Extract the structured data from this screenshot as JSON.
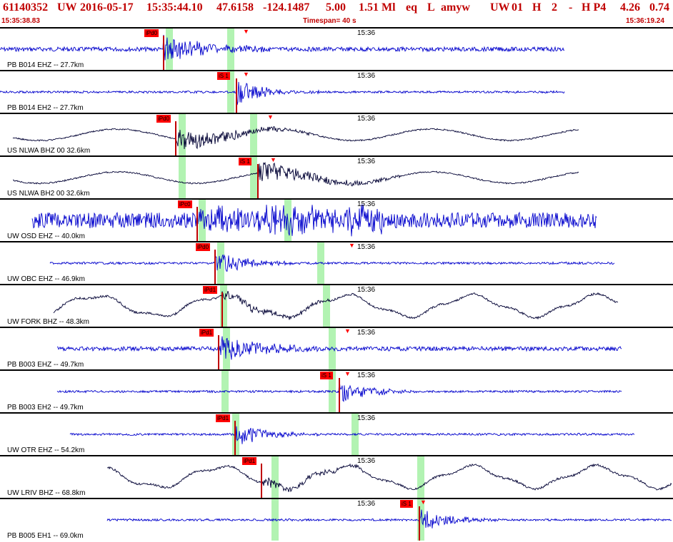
{
  "header": {
    "evid": "61140352",
    "net": "UW",
    "date": "2016-05-17",
    "time": "15:35:44.10",
    "lat": "47.6158",
    "lon": "-124.1487",
    "depth": "5.00",
    "mag": "1.51 Ml",
    "etype": "eq",
    "status": "L",
    "author": "amyw",
    "src": "UW",
    "ver": "01",
    "gtype": "H",
    "n": "2",
    "dash": "-",
    "q": "H P4",
    "rms": "4.26",
    "err": "0.74"
  },
  "subheader": {
    "start": "15:35:38.83",
    "timespan": "Timespan=  40 s",
    "end": "15:36:19.24"
  },
  "colors": {
    "header_red": "#c00000",
    "trace_blue": "#0000cc",
    "trace_dark": "#000033",
    "pick_green": "#aaf2aa",
    "pick_red": "#ff0000"
  },
  "channels": [
    {
      "label": "PB B014 EHZ --  27.7km",
      "time_mark": "15:36",
      "pick": "iPd0",
      "trace_color": "#0000cc",
      "style": "noise_burst"
    },
    {
      "label": "PB B014 EH2 --  27.7km",
      "time_mark": "15:36",
      "pick": "iS 1",
      "trace_color": "#0000cc",
      "style": "quiet_burst"
    },
    {
      "label": "US NLWA BHZ 00  32.6km",
      "time_mark": "15:36",
      "pick": "iPd0",
      "trace_color": "#000033",
      "style": "long_period"
    },
    {
      "label": "US NLWA BH2 00  32.6km",
      "time_mark": "15:36",
      "pick": "iS 1",
      "trace_color": "#000033",
      "style": "long_period"
    },
    {
      "label": "UW OSD EHZ --  40.0km",
      "time_mark": "15:36",
      "pick": "iPc0",
      "trace_color": "#0000cc",
      "style": "very_noisy"
    },
    {
      "label": "UW OBC EHZ --  46.9km",
      "time_mark": "15:36",
      "pick": "iPd0",
      "trace_color": "#0000cc",
      "style": "quiet_burst"
    },
    {
      "label": "UW FORK BHZ --  48.3km",
      "time_mark": "15:36",
      "pick": "iPd1",
      "trace_color": "#000033",
      "style": "waves"
    },
    {
      "label": "PB B003 EHZ --  49.7km",
      "time_mark": "15:36",
      "pick": "iPd1",
      "trace_color": "#0000cc",
      "style": "noise_burst"
    },
    {
      "label": "PB B003 EH2 --  49.7km",
      "time_mark": "15:36",
      "pick": "iS 1",
      "trace_color": "#0000cc",
      "style": "quiet_burst"
    },
    {
      "label": "UW OTR EHZ --  54.2km",
      "time_mark": "15:36",
      "pick": "iPd1",
      "trace_color": "#0000cc",
      "style": "quiet_burst"
    },
    {
      "label": "UW LRIV BHZ --  68.8km",
      "time_mark": "15:36",
      "pick": "iPd1",
      "trace_color": "#000033",
      "style": "waves"
    },
    {
      "label": "PB B005 EH1 --  69.0km",
      "time_mark": "15:36",
      "pick": "iS 1",
      "trace_color": "#0000cc",
      "style": "quiet_burst"
    }
  ]
}
